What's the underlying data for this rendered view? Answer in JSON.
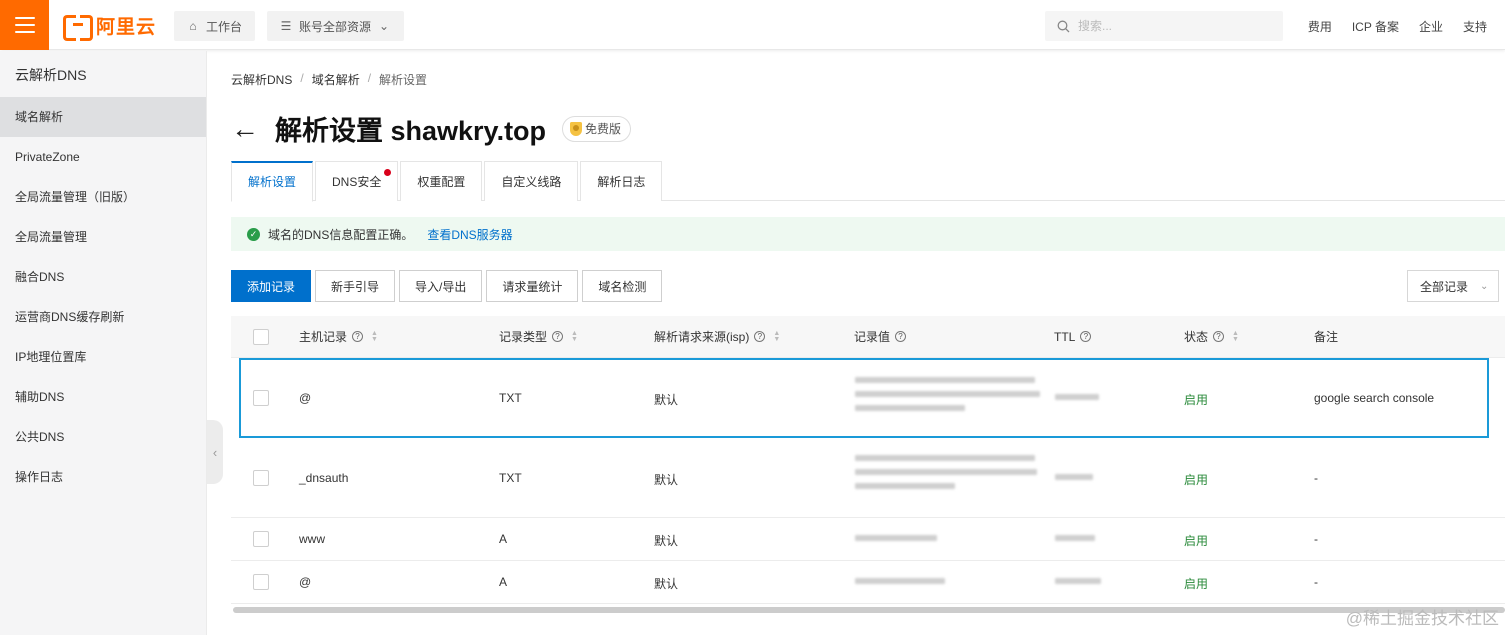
{
  "topbar": {
    "logo_text": "阿里云",
    "workbench": "工作台",
    "resources": "账号全部资源",
    "search_placeholder": "搜索...",
    "links": [
      "费用",
      "ICP 备案",
      "企业",
      "支持"
    ]
  },
  "sidebar": {
    "title": "云解析DNS",
    "items": [
      {
        "label": "域名解析",
        "active": true
      },
      {
        "label": "PrivateZone"
      },
      {
        "label": "全局流量管理（旧版）"
      },
      {
        "label": "全局流量管理"
      },
      {
        "label": "融合DNS"
      },
      {
        "label": "运营商DNS缓存刷新"
      },
      {
        "label": "IP地理位置库"
      },
      {
        "label": "辅助DNS"
      },
      {
        "label": "公共DNS"
      },
      {
        "label": "操作日志"
      }
    ]
  },
  "breadcrumb": [
    "云解析DNS",
    "域名解析",
    "解析设置"
  ],
  "page": {
    "title": "解析设置 shawkry.top",
    "edition": "免费版"
  },
  "tabs": [
    "解析设置",
    "DNS安全",
    "权重配置",
    "自定义线路",
    "解析日志"
  ],
  "notice": {
    "text": "域名的DNS信息配置正确。",
    "link": "查看DNS服务器"
  },
  "toolbar": {
    "add": "添加记录",
    "guide": "新手引导",
    "import_export": "导入/导出",
    "stats": "请求量统计",
    "check": "域名检测",
    "filter": "全部记录"
  },
  "table": {
    "headers": [
      "主机记录",
      "记录类型",
      "解析请求来源(isp)",
      "记录值",
      "TTL",
      "状态",
      "备注"
    ],
    "rows": [
      {
        "host": "@",
        "type": "TXT",
        "line": "默认",
        "status": "启用",
        "remark": "google search console"
      },
      {
        "host": "_dnsauth",
        "type": "TXT",
        "line": "默认",
        "status": "启用",
        "remark": "-"
      },
      {
        "host": "www",
        "type": "A",
        "line": "默认",
        "status": "启用",
        "remark": "-"
      },
      {
        "host": "@",
        "type": "A",
        "line": "默认",
        "status": "启用",
        "remark": "-"
      }
    ]
  },
  "watermark": "@稀土掘金技术社区",
  "colors": {
    "brand": "#ff6a00",
    "primary": "#0070cc",
    "success": "#2a8a3a"
  }
}
